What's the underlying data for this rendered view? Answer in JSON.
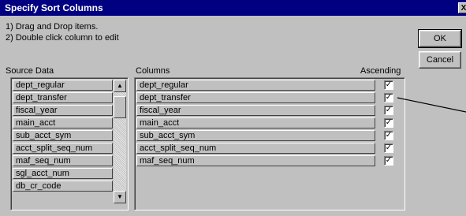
{
  "window": {
    "title": "Specify Sort Columns",
    "close_label": "X"
  },
  "instructions": [
    "1) Drag and Drop items.",
    "2) Double click column to edit"
  ],
  "buttons": {
    "ok": "OK",
    "cancel": "Cancel"
  },
  "source_data": {
    "header": "Source Data",
    "items": [
      "dept_regular",
      "dept_transfer",
      "fiscal_year",
      "main_acct",
      "sub_acct_sym",
      "acct_split_seq_num",
      "maf_seq_num",
      "sgl_acct_num",
      "db_cr_code"
    ],
    "scroll_up": "▲",
    "scroll_down": "▼"
  },
  "columns": {
    "header": "Columns",
    "ascending_header": "Ascending",
    "check_mark": "✓",
    "rows": [
      {
        "name": "dept_regular",
        "ascending": true
      },
      {
        "name": "dept_transfer",
        "ascending": true
      },
      {
        "name": "fiscal_year",
        "ascending": true
      },
      {
        "name": "main_acct",
        "ascending": true
      },
      {
        "name": "sub_acct_sym",
        "ascending": true
      },
      {
        "name": "acct_split_seq_num",
        "ascending": true
      },
      {
        "name": "maf_seq_num",
        "ascending": true
      }
    ]
  }
}
